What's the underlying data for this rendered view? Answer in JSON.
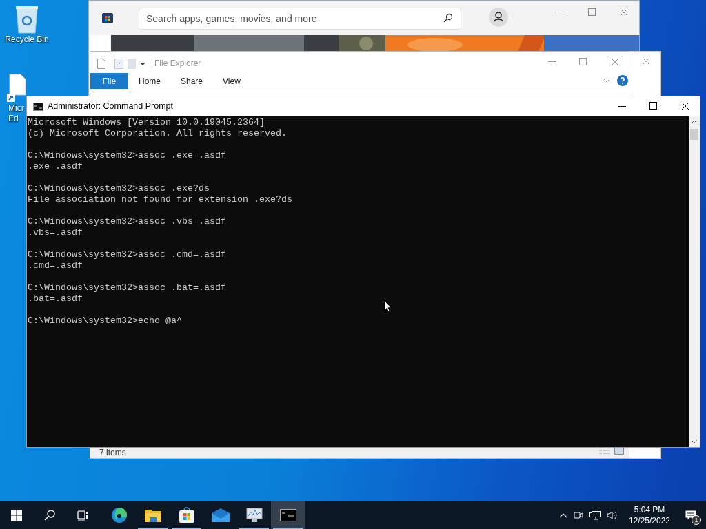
{
  "desktop_icons": [
    {
      "kind": "recycle",
      "lines": [
        "Recycle Bin"
      ]
    },
    {
      "kind": "shortcut",
      "lines": [
        "Micr",
        "Ed"
      ]
    }
  ],
  "store_window": {
    "search": {
      "placeholder": "Search apps, games, movies, and more"
    }
  },
  "file_explorer": {
    "title": "File Explorer",
    "tabs": [
      {
        "label": "File",
        "selected": true
      },
      {
        "label": "Home",
        "selected": false
      },
      {
        "label": "Share",
        "selected": false
      },
      {
        "label": "View",
        "selected": false
      }
    ],
    "status": "7 items"
  },
  "command_prompt": {
    "title": "Administrator: Command Prompt",
    "blocks": [
      [
        "Microsoft Windows [Version 10.0.19045.2364]",
        "(c) Microsoft Corporation. All rights reserved."
      ],
      [
        "C:\\Windows\\system32>assoc .exe=.asdf",
        ".exe=.asdf"
      ],
      [
        "C:\\Windows\\system32>assoc .exe?ds",
        "File association not found for extension .exe?ds"
      ],
      [
        "C:\\Windows\\system32>assoc .vbs=.asdf",
        ".vbs=.asdf"
      ],
      [
        "C:\\Windows\\system32>assoc .cmd=.asdf",
        ".cmd=.asdf"
      ],
      [
        "C:\\Windows\\system32>assoc .bat=.asdf",
        ".bat=.asdf"
      ],
      [
        "C:\\Windows\\system32>echo @a^"
      ]
    ]
  },
  "taskbar": {
    "apps": [
      {
        "kind": "edge",
        "running": false,
        "active": false
      },
      {
        "kind": "explorer",
        "running": true,
        "active": false
      },
      {
        "kind": "store",
        "running": true,
        "active": false
      },
      {
        "kind": "mail",
        "running": false,
        "active": false
      },
      {
        "kind": "monitor",
        "running": true,
        "active": false
      },
      {
        "kind": "console",
        "running": true,
        "active": true
      }
    ],
    "time": "5:04 PM",
    "date": "12/25/2022",
    "notification_count": "1"
  }
}
